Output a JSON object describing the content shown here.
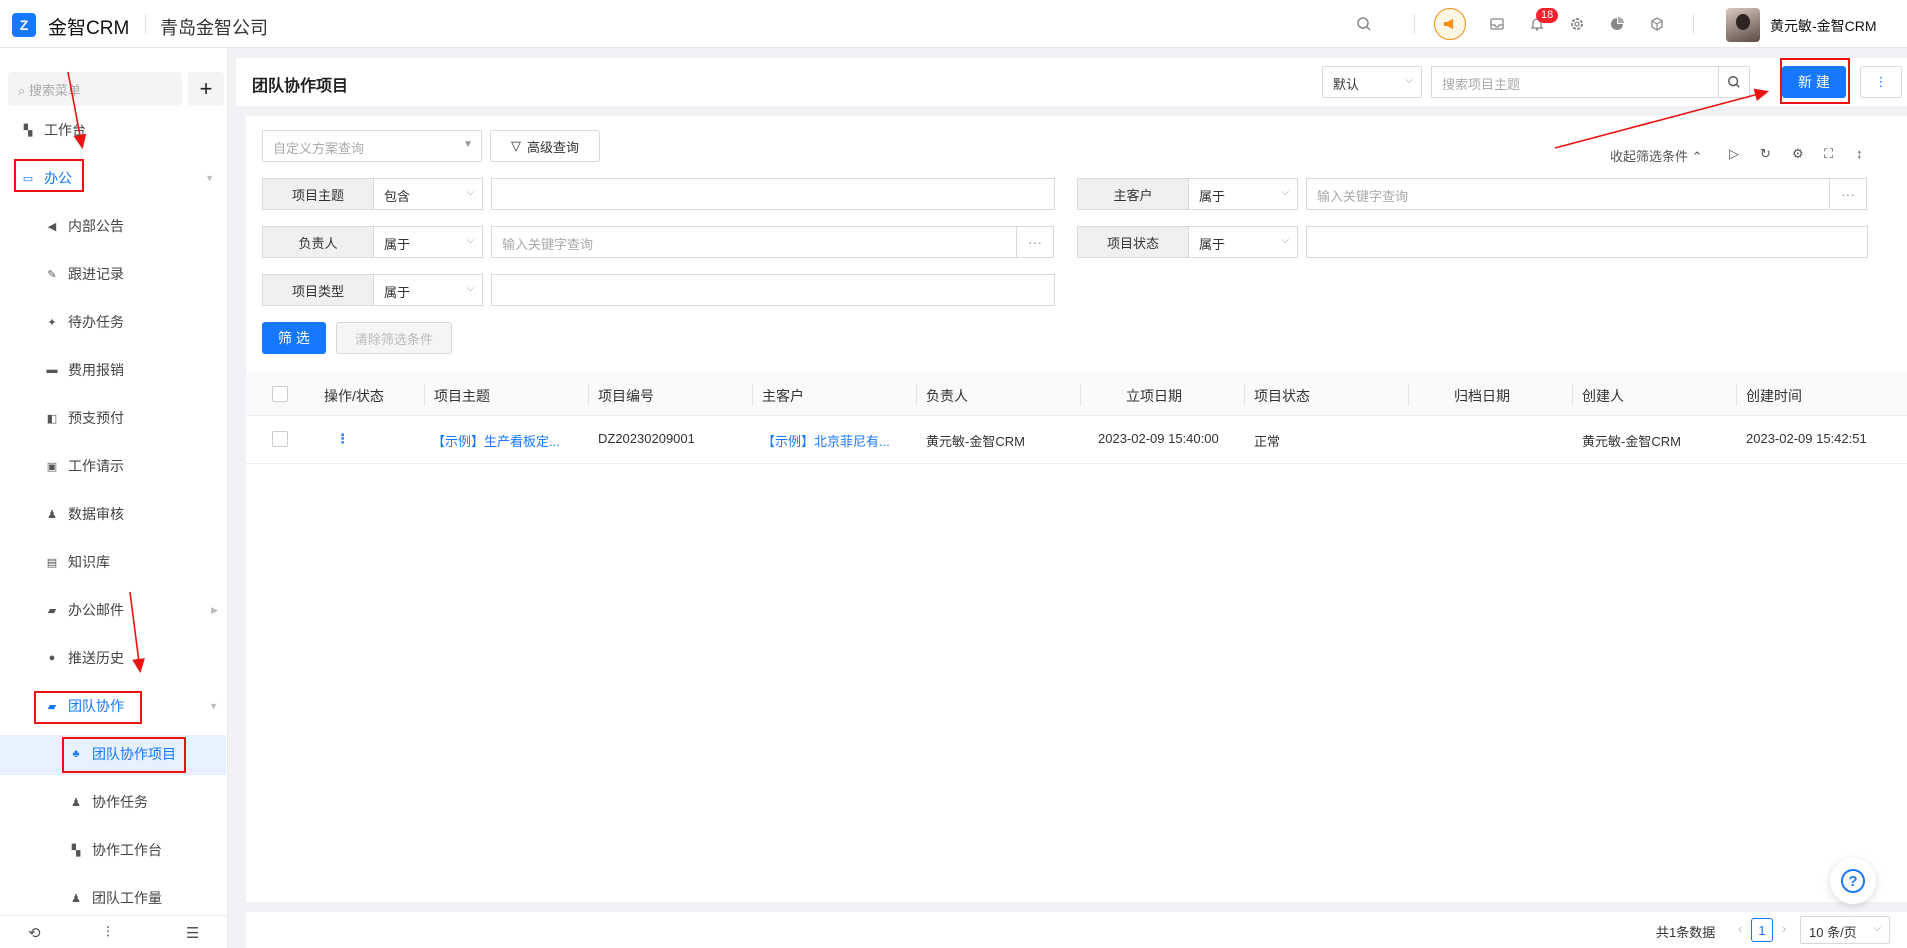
{
  "topbar": {
    "logo_glyph": "Z",
    "brand": "金智CRM",
    "company": "青岛金智公司",
    "notification_count": "18",
    "username": "黄元敏-金智CRM"
  },
  "sidebar": {
    "search_placeholder": "搜索菜单",
    "add_label": "+",
    "items": [
      {
        "label": "工作台",
        "icon": "dashboard-icon"
      },
      {
        "label": "办公",
        "icon": "desktop-icon"
      },
      {
        "label": "内部公告",
        "icon": "speaker-icon"
      },
      {
        "label": "跟进记录",
        "icon": "edit-icon"
      },
      {
        "label": "待办任务",
        "icon": "pin-icon"
      },
      {
        "label": "费用报销",
        "icon": "card-icon"
      },
      {
        "label": "预支预付",
        "icon": "wallet-icon"
      },
      {
        "label": "工作请示",
        "icon": "message-icon"
      },
      {
        "label": "数据审核",
        "icon": "stamp-icon"
      },
      {
        "label": "知识库",
        "icon": "book-icon"
      },
      {
        "label": "办公邮件",
        "icon": "folder-icon"
      },
      {
        "label": "推送历史",
        "icon": "clock-icon"
      },
      {
        "label": "团队协作",
        "icon": "folder-open-icon"
      },
      {
        "label": "团队协作项目",
        "icon": "team-icon"
      },
      {
        "label": "协作任务",
        "icon": "user-icon"
      },
      {
        "label": "协作工作台",
        "icon": "dashboard-icon"
      },
      {
        "label": "团队工作量",
        "icon": "user-icon"
      }
    ]
  },
  "header": {
    "title": "团队协作项目",
    "view_select": "默认",
    "search_placeholder": "搜索项目主题",
    "new_button": "新 建",
    "more": "⋮"
  },
  "filter": {
    "scheme_placeholder": "自定义方案查询",
    "advanced": "高级查询",
    "collapse": "收起筛选条件",
    "fields": [
      {
        "label": "项目主题",
        "op": "包含",
        "value": ""
      },
      {
        "label": "主客户",
        "op": "属于",
        "value": "输入关键字查询"
      },
      {
        "label": "负责人",
        "op": "属于",
        "value": "输入关键字查询"
      },
      {
        "label": "项目状态",
        "op": "属于",
        "value": ""
      },
      {
        "label": "项目类型",
        "op": "属于",
        "value": ""
      }
    ],
    "dots": "···",
    "apply": "筛 选",
    "clear": "清除筛选条件"
  },
  "table": {
    "columns": [
      "操作/状态",
      "项目主题",
      "项目编号",
      "主客户",
      "负责人",
      "立项日期",
      "项目状态",
      "归档日期",
      "创建人",
      "创建时间"
    ],
    "rows": [
      {
        "action": "⋮",
        "subject": "【示例】生产看板定...",
        "code": "DZ20230209001",
        "customer": "【示例】北京菲尼有...",
        "owner": "黄元敏-金智CRM",
        "start": "2023-02-09 15:40:00",
        "status": "正常",
        "archive": "",
        "creator": "黄元敏-金智CRM",
        "created": "2023-02-09 15:42:51"
      }
    ]
  },
  "footer": {
    "total": "共1条数据",
    "page": "1",
    "page_size": "10 条/页"
  },
  "help": "?",
  "colors": {
    "primary": "#1677ff",
    "annotation": "#e11111"
  }
}
